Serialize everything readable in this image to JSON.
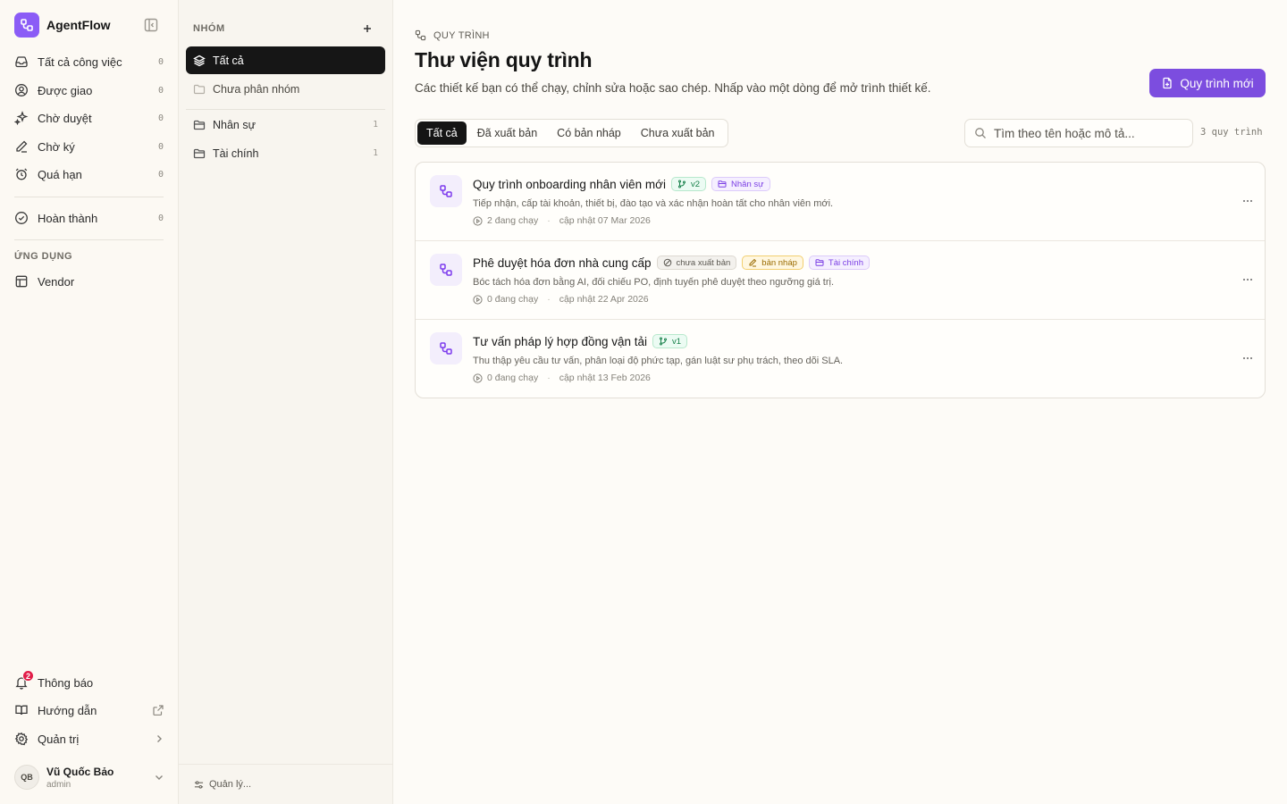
{
  "app": {
    "name": "AgentFlow",
    "brand_color": "#8b5cf6"
  },
  "sidebar": {
    "nav": [
      {
        "label": "Tất cả công việc",
        "count": "0",
        "icon": "inbox-icon"
      },
      {
        "label": "Được giao",
        "count": "0",
        "icon": "user-circle-icon"
      },
      {
        "label": "Chờ duyệt",
        "count": "0",
        "icon": "sparkles-icon"
      },
      {
        "label": "Chờ ký",
        "count": "0",
        "icon": "pen-icon"
      },
      {
        "label": "Quá hạn",
        "count": "0",
        "icon": "alarm-clock-icon"
      }
    ],
    "done": {
      "label": "Hoàn thành",
      "count": "0",
      "icon": "check-circle-icon"
    },
    "apps_label": "ỨNG DỤNG",
    "apps": [
      {
        "label": "Vendor",
        "icon": "table-icon"
      }
    ],
    "bottom": {
      "notifications": {
        "label": "Thông báo",
        "badge": "2"
      },
      "guide": {
        "label": "Hướng dẫn"
      },
      "admin": {
        "label": "Quản trị"
      }
    },
    "user": {
      "initials": "QB",
      "name": "Vũ Quốc Bảo",
      "role": "admin"
    }
  },
  "groups": {
    "title": "NHÓM",
    "items": [
      {
        "label": "Tất cả",
        "count": "",
        "active": true
      },
      {
        "label": "Chưa phân nhóm",
        "count": ""
      },
      {
        "label": "Nhân sự",
        "count": "1"
      },
      {
        "label": "Tài chính",
        "count": "1"
      }
    ],
    "manage_label": "Quản lý..."
  },
  "main": {
    "breadcrumb": "QUY TRÌNH",
    "title": "Thư viện quy trình",
    "subtitle": "Các thiết kế bạn có thể chạy, chỉnh sửa hoặc sao chép. Nhấp vào một dòng để mở trình thiết kế.",
    "new_button": "Quy trình mới",
    "tabs": [
      "Tất cả",
      "Đã xuất bản",
      "Có bản nháp",
      "Chưa xuất bản"
    ],
    "active_tab": "Tất cả",
    "search_placeholder": "Tìm theo tên hoặc mô tả...",
    "count_label": "3 quy trình",
    "accent_color": "#7c4ddf",
    "workflows": [
      {
        "title": "Quy trình onboarding nhân viên mới",
        "version": "v2",
        "status": "",
        "draft": "",
        "group": "Nhân sự",
        "description": "Tiếp nhận, cấp tài khoản, thiết bị, đào tạo và xác nhận hoàn tất cho nhân viên mới.",
        "running": "2 đang chạy",
        "updated": "cập nhật 07 Mar 2026"
      },
      {
        "title": "Phê duyệt hóa đơn nhà cung cấp",
        "version": "",
        "status": "chưa xuất bản",
        "draft": "bản nháp",
        "group": "Tài chính",
        "description": "Bóc tách hóa đơn bằng AI, đối chiếu PO, định tuyến phê duyệt theo ngưỡng giá trị.",
        "running": "0 đang chạy",
        "updated": "cập nhật 22 Apr 2026"
      },
      {
        "title": "Tư vấn pháp lý hợp đồng vận tải",
        "version": "v1",
        "status": "",
        "draft": "",
        "group": "",
        "description": "Thu thập yêu cầu tư vấn, phân loại độ phức tạp, gán luật sư phụ trách, theo dõi SLA.",
        "running": "0 đang chạy",
        "updated": "cập nhật 13 Feb 2026"
      }
    ]
  }
}
